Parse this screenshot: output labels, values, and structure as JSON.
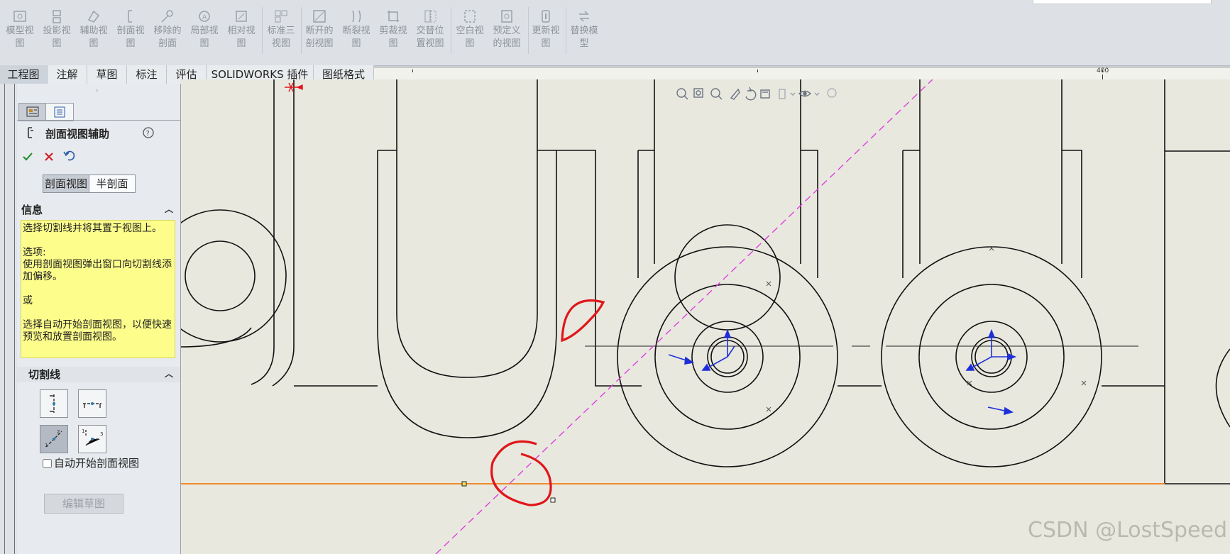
{
  "toolbar": {
    "buttons": [
      {
        "label": "模型视\n图",
        "icon": "model-view-icon"
      },
      {
        "label": "投影视\n图",
        "icon": "projected-view-icon"
      },
      {
        "label": "辅助视\n图",
        "icon": "auxiliary-view-icon"
      },
      {
        "label": "剖面视\n图",
        "icon": "section-view-icon"
      },
      {
        "label": "移除的\n剖面",
        "icon": "removed-section-icon"
      },
      {
        "label": "局部视\n图",
        "icon": "detail-view-icon"
      },
      {
        "label": "相对视\n图",
        "icon": "relative-view-icon"
      },
      {
        "label": "标准三\n视图",
        "icon": "standard-3-view-icon"
      },
      {
        "label": "断开的\n剖视图",
        "icon": "broken-out-section-icon"
      },
      {
        "label": "断裂视\n图",
        "icon": "break-view-icon"
      },
      {
        "label": "剪裁视\n图",
        "icon": "crop-view-icon"
      },
      {
        "label": "交替位\n置视图",
        "icon": "alternate-position-view-icon"
      },
      {
        "label": "空白视\n图",
        "icon": "empty-view-icon"
      },
      {
        "label": "预定义\n的视图",
        "icon": "predefined-view-icon"
      },
      {
        "label": "更新视\n图",
        "icon": "update-view-icon"
      },
      {
        "label": "替换模\n型",
        "icon": "replace-model-icon"
      }
    ]
  },
  "tabs": [
    "工程图",
    "注解",
    "草图",
    "标注",
    "评估",
    "SOLIDWORKS 插件",
    "图纸格式"
  ],
  "active_tab": "工程图",
  "ruler": {
    "mark": "400"
  },
  "panel": {
    "title": "剖面视图辅助",
    "mode_tabs": [
      "剖面视图",
      "半剖面"
    ],
    "info_header": "信息",
    "info_text": "选择切割线并将其置于视图上。\n\n选项:\n使用剖面视图弹出窗口向切割线添加偏移。\n\n或\n\n选择自动开始剖面视图，以便快速预览和放置剖面视图。",
    "cutting_line_header": "切割线",
    "auto_start_label": "自动开始剖面视图",
    "edit_sketch_label": "编辑草图"
  },
  "watermark": "CSDN @LostSpeed",
  "colors": {
    "canvas": "#e8e8df",
    "info_bg": "#fdfd8c",
    "accent_orange": "#f08a2a",
    "annotation_red": "#e0161a",
    "dashed_line": "#e040e0",
    "axis_blue": "#1f2fd8"
  }
}
